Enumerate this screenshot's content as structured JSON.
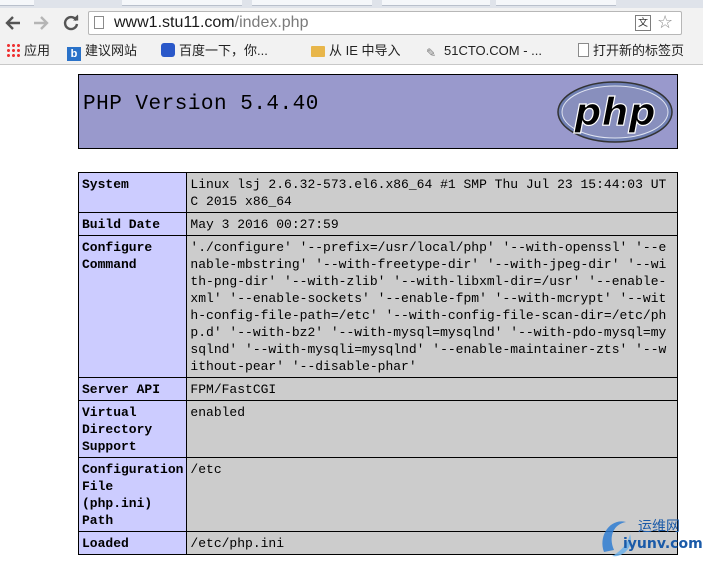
{
  "browser": {
    "url_host": "www1.stu11.com",
    "url_path": "/index.php",
    "translate_glyph": "文",
    "bookmarks": [
      {
        "label": "应用",
        "icon": "apps-grid-icon"
      },
      {
        "label": "建议网站",
        "icon": "bing-icon"
      },
      {
        "label": "百度一下，你...",
        "icon": "baidu-paw-icon"
      },
      {
        "label": "从 IE 中导入",
        "icon": "folder-icon"
      },
      {
        "label": "51CTO.COM - ...",
        "icon": "paperclip-icon"
      },
      {
        "label": "打开新的标签页",
        "icon": "page-icon"
      }
    ]
  },
  "php": {
    "title": "PHP Version 5.4.40",
    "logo_text": "php",
    "rows": [
      {
        "key": "System",
        "value": "Linux lsj 2.6.32-573.el6.x86_64 #1 SMP Thu Jul 23 15:44:03 UTC 2015 x86_64"
      },
      {
        "key": "Build Date",
        "value": "May 3 2016 00:27:59"
      },
      {
        "key": "Configure Command",
        "value": "'./configure' '--prefix=/usr/local/php' '--with-openssl' '--enable-mbstring' '--with-freetype-dir' '--with-jpeg-dir' '--with-png-dir' '--with-zlib' '--with-libxml-dir=/usr' '--enable-xml' '--enable-sockets' '--enable-fpm' '--with-mcrypt' '--with-config-file-path=/etc' '--with-config-file-scan-dir=/etc/php.d' '--with-bz2' '--with-mysql=mysqlnd' '--with-pdo-mysql=mysqlnd' '--with-mysqli=mysqlnd' '--enable-maintainer-zts' '--without-pear' '--disable-phar'"
      },
      {
        "key": "Server API",
        "value": "FPM/FastCGI"
      },
      {
        "key": "Virtual Directory Support",
        "value": "enabled"
      },
      {
        "key": "Configuration File (php.ini) Path",
        "value": "/etc"
      },
      {
        "key": "Loaded",
        "value": "/etc/php.ini"
      }
    ]
  },
  "watermark": {
    "line1": "运维网",
    "line2": "iyunv.com"
  },
  "colors": {
    "header_bg": "#9999cc",
    "key_bg": "#ccccff",
    "value_bg": "#cccccc"
  }
}
